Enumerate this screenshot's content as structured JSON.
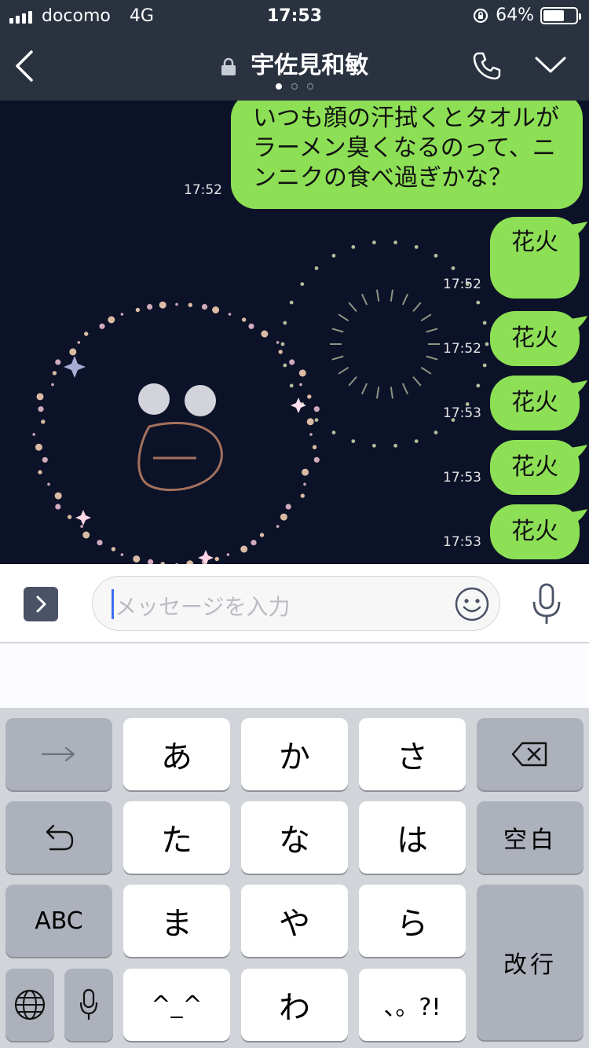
{
  "status_bar": {
    "carrier": "docomo",
    "network": "4G",
    "time": "17:53",
    "battery": "64%",
    "battery_level": 0.64
  },
  "header": {
    "title": "宇佐見和敏",
    "page_dots": 3,
    "active_dot": 0,
    "icons": [
      "back-chevron-icon",
      "lock-icon",
      "phone-icon",
      "chevron-down-icon"
    ]
  },
  "messages": [
    {
      "text": "いつも顔の汗拭くとタオルがラーメン臭くなるのって、ニンニクの食べ過ぎかな？",
      "time": "17:52"
    },
    {
      "text": "花火",
      "time": "17:52"
    },
    {
      "text": "花火",
      "time": "17:52"
    },
    {
      "text": "花火",
      "time": "17:53"
    },
    {
      "text": "花火",
      "time": "17:53"
    },
    {
      "text": "花火",
      "time": "17:53"
    }
  ],
  "input": {
    "placeholder": "メッセージを入力"
  },
  "keyboard": {
    "rows": [
      [
        "→",
        "あ",
        "か",
        "さ",
        "⌫"
      ],
      [
        "↺",
        "た",
        "な",
        "は",
        "空白"
      ],
      [
        "ABC",
        "ま",
        "や",
        "ら",
        "改行"
      ],
      [
        "globe",
        "mic",
        "^^",
        "わ",
        "、。?!"
      ]
    ],
    "space_label": "空白",
    "return_label": "改行",
    "abc_label": "ABC",
    "kaomoji_label": "^_^",
    "punct_label": "、。?!"
  },
  "colors": {
    "header_bg": "#2a3240",
    "chat_bg": "#0c1228",
    "bubble": "#8de055",
    "keyboard_bg": "#d1d4d9",
    "caret": "#3b6ef6"
  }
}
